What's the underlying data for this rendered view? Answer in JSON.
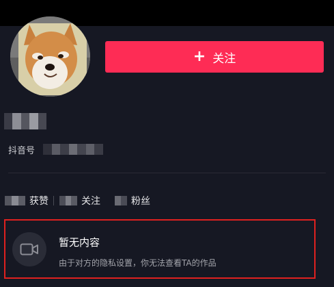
{
  "profile": {
    "follow_button": {
      "icon": "plus-icon",
      "plus": "+",
      "label": "关注"
    },
    "id_label": "抖音号"
  },
  "stats": {
    "likes_label": "获赞",
    "following_label": "关注",
    "followers_label": "粉丝"
  },
  "empty_state": {
    "icon": "video-camera-icon",
    "title": "暂无内容",
    "subtitle": "由于对方的隐私设置，你无法查看TA的作品"
  },
  "colors": {
    "background": "#161823",
    "accent": "#fe2c55",
    "highlight_border": "#e0211f"
  }
}
